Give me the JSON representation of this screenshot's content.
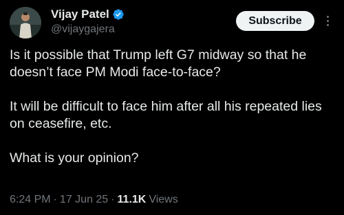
{
  "author": {
    "name": "Vijay Patel",
    "handle": "@vijaygajera",
    "verified": true
  },
  "actions": {
    "subscribe_label": "Subscribe",
    "more_icon": "more-vertical-icon"
  },
  "tweet": {
    "paragraphs": [
      "Is it possible that Trump left G7 midway so that he doesn’t face PM Modi face-to-face?",
      "It will be difficult to face him after all his repeated lies on ceasefire, etc.",
      "What is your opinion?"
    ],
    "time": "6:24 PM",
    "date": "17 Jun 25",
    "separator": "·",
    "views_count": "11.1K",
    "views_label": "Views"
  },
  "colors": {
    "background": "#000000",
    "text": "#e7e9ea",
    "muted": "#71767b",
    "verified_badge": "#1d9bf0",
    "subscribe_bg": "#eff3f4"
  }
}
